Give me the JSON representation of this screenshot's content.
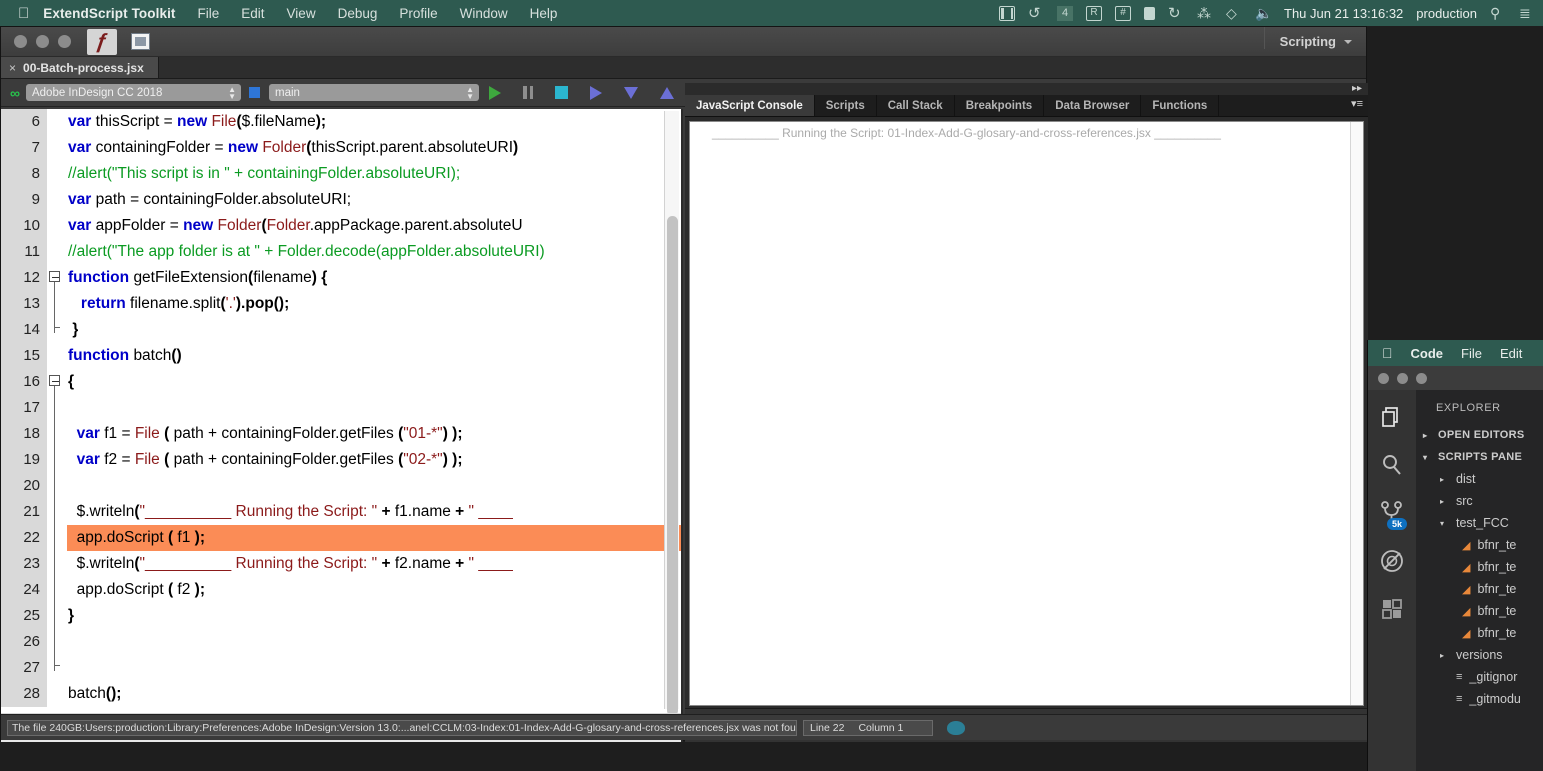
{
  "mac_menu": {
    "apple_icon": "apple-logo-icon",
    "app_name": "ExtendScript Toolkit",
    "items": [
      "File",
      "Edit",
      "View",
      "Debug",
      "Profile",
      "Window",
      "Help"
    ],
    "status_icons": [
      "film-strip-icon",
      "time-machine-icon",
      "four-badge-icon",
      "bartender-icon",
      "grid-icon",
      "lock-icon",
      "backup-icon",
      "bluetooth-icon",
      "vpn-shield-icon",
      "volume-icon"
    ],
    "clock": "Thu Jun 21  13:16:32",
    "user": "production",
    "search_icon": "spotlight-search-icon",
    "list_icon": "notification-center-icon"
  },
  "estk": {
    "window_icons": [
      "extendscript-icon",
      "window-layout-icon"
    ],
    "workspace_label": "Scripting",
    "tab": {
      "close_glyph": "×",
      "title": "00-Batch-process.jsx"
    },
    "toolbar": {
      "chain_icon": "connection-chain-icon",
      "target_app": "Adobe InDesign CC 2018",
      "target_function": "main",
      "buttons": [
        "run-button",
        "pause-button",
        "stop-button",
        "step-over-button",
        "step-into-button",
        "step-out-button"
      ],
      "panel_menu_icon": "panel-menu-icon"
    },
    "code_lines": [
      {
        "n": "6",
        "fold": "",
        "indent": 0,
        "tokens": [
          {
            "t": "var ",
            "c": "kw"
          },
          {
            "t": "thisScript = ",
            "c": ""
          },
          {
            "t": "new ",
            "c": "kw"
          },
          {
            "t": "File",
            "c": "cls"
          },
          {
            "t": "(",
            "c": "bd"
          },
          {
            "t": "$.fileName",
            "c": ""
          },
          {
            "t": ");",
            "c": "bd"
          }
        ]
      },
      {
        "n": "7",
        "fold": "",
        "indent": 0,
        "tokens": [
          {
            "t": "var ",
            "c": "kw"
          },
          {
            "t": "containingFolder = ",
            "c": ""
          },
          {
            "t": "new ",
            "c": "kw"
          },
          {
            "t": "Folder",
            "c": "cls"
          },
          {
            "t": "(",
            "c": "bd"
          },
          {
            "t": "thisScript.parent.absoluteURI",
            "c": ""
          },
          {
            "t": ")",
            "c": "bd"
          }
        ]
      },
      {
        "n": "8",
        "fold": "",
        "indent": 0,
        "tokens": [
          {
            "t": "//alert(\"This script is in \" + containingFolder.absoluteURI);",
            "c": "cm"
          }
        ]
      },
      {
        "n": "9",
        "fold": "",
        "indent": 0,
        "tokens": [
          {
            "t": "var ",
            "c": "kw"
          },
          {
            "t": "path = containingFolder.absoluteURI;",
            "c": ""
          }
        ]
      },
      {
        "n": "10",
        "fold": "",
        "indent": 0,
        "tokens": [
          {
            "t": "var ",
            "c": "kw"
          },
          {
            "t": "appFolder = ",
            "c": ""
          },
          {
            "t": "new ",
            "c": "kw"
          },
          {
            "t": "Folder",
            "c": "cls"
          },
          {
            "t": "(",
            "c": "bd"
          },
          {
            "t": "Folder",
            "c": "cls"
          },
          {
            "t": ".appPackage.parent.absoluteU",
            "c": ""
          }
        ]
      },
      {
        "n": "11",
        "fold": "",
        "indent": 0,
        "tokens": [
          {
            "t": "//alert(\"The app folder is at \" + Folder.decode(appFolder.absoluteURI)",
            "c": "cm"
          }
        ]
      },
      {
        "n": "12",
        "fold": "open",
        "indent": 0,
        "tokens": [
          {
            "t": "function ",
            "c": "kw"
          },
          {
            "t": "getFileExtension",
            "c": ""
          },
          {
            "t": "(",
            "c": "bd"
          },
          {
            "t": "filename",
            "c": ""
          },
          {
            "t": ") {",
            "c": "bd"
          }
        ]
      },
      {
        "n": "13",
        "fold": "bar",
        "indent": 0,
        "tokens": [
          {
            "t": "   ",
            "c": ""
          },
          {
            "t": "return ",
            "c": "kw"
          },
          {
            "t": "filename.split",
            "c": ""
          },
          {
            "t": "(",
            "c": "bd"
          },
          {
            "t": "'.'",
            "c": "st"
          },
          {
            "t": ").pop();",
            "c": "bd"
          }
        ]
      },
      {
        "n": "14",
        "fold": "barend",
        "indent": 0,
        "tokens": [
          {
            "t": " ",
            "c": ""
          },
          {
            "t": "}",
            "c": "bd"
          }
        ]
      },
      {
        "n": "15",
        "fold": "",
        "indent": 0,
        "tokens": [
          {
            "t": "function ",
            "c": "kw"
          },
          {
            "t": "batch",
            "c": ""
          },
          {
            "t": "()",
            "c": "bd"
          }
        ]
      },
      {
        "n": "16",
        "fold": "open",
        "indent": 0,
        "tokens": [
          {
            "t": "{",
            "c": "bd"
          }
        ]
      },
      {
        "n": "17",
        "fold": "bar",
        "indent": 0,
        "tokens": [
          {
            "t": "",
            "c": ""
          }
        ]
      },
      {
        "n": "18",
        "fold": "bar",
        "indent": 0,
        "tokens": [
          {
            "t": "  ",
            "c": ""
          },
          {
            "t": "var ",
            "c": "kw"
          },
          {
            "t": "f1 = ",
            "c": ""
          },
          {
            "t": "File ",
            "c": "cls"
          },
          {
            "t": "(",
            "c": "bd"
          },
          {
            "t": " path + containingFolder.getFiles ",
            "c": ""
          },
          {
            "t": "(",
            "c": "bd"
          },
          {
            "t": "\"01-*\"",
            "c": "st"
          },
          {
            "t": ") );",
            "c": "bd"
          }
        ]
      },
      {
        "n": "19",
        "fold": "bar",
        "indent": 0,
        "tokens": [
          {
            "t": "  ",
            "c": ""
          },
          {
            "t": "var ",
            "c": "kw"
          },
          {
            "t": "f2 = ",
            "c": ""
          },
          {
            "t": "File ",
            "c": "cls"
          },
          {
            "t": "(",
            "c": "bd"
          },
          {
            "t": " path + containingFolder.getFiles ",
            "c": ""
          },
          {
            "t": "(",
            "c": "bd"
          },
          {
            "t": "\"02-*\"",
            "c": "st"
          },
          {
            "t": ") );",
            "c": "bd"
          }
        ]
      },
      {
        "n": "20",
        "fold": "bar",
        "indent": 0,
        "tokens": [
          {
            "t": "",
            "c": ""
          }
        ]
      },
      {
        "n": "21",
        "fold": "bar",
        "indent": 0,
        "tokens": [
          {
            "t": "  $.writeln",
            "c": ""
          },
          {
            "t": "(",
            "c": "bd"
          },
          {
            "t": "\"__________ Running the Script: \"",
            "c": "st"
          },
          {
            "t": " + ",
            "c": "bd"
          },
          {
            "t": "f1.name",
            "c": ""
          },
          {
            "t": " + ",
            "c": "bd"
          },
          {
            "t": "\" ____",
            "c": "st"
          }
        ]
      },
      {
        "n": "22",
        "fold": "bar",
        "indent": 0,
        "highlight": true,
        "tokens": [
          {
            "t": "  app.doScript ",
            "c": ""
          },
          {
            "t": "( ",
            "c": "bd"
          },
          {
            "t": "f1",
            "c": ""
          },
          {
            "t": " );",
            "c": "bd"
          }
        ]
      },
      {
        "n": "23",
        "fold": "bar",
        "indent": 0,
        "tokens": [
          {
            "t": "  $.writeln",
            "c": ""
          },
          {
            "t": "(",
            "c": "bd"
          },
          {
            "t": "\"__________ Running the Script: \"",
            "c": "st"
          },
          {
            "t": " + ",
            "c": "bd"
          },
          {
            "t": "f2.name",
            "c": ""
          },
          {
            "t": " + ",
            "c": "bd"
          },
          {
            "t": "\" ____",
            "c": "st"
          }
        ]
      },
      {
        "n": "24",
        "fold": "bar",
        "indent": 0,
        "tokens": [
          {
            "t": "  app.doScript ",
            "c": ""
          },
          {
            "t": "( ",
            "c": "bd"
          },
          {
            "t": "f2",
            "c": ""
          },
          {
            "t": " );",
            "c": "bd"
          }
        ]
      },
      {
        "n": "25",
        "fold": "bar",
        "indent": 0,
        "tokens": [
          {
            "t": "}",
            "c": "bd"
          }
        ]
      },
      {
        "n": "26",
        "fold": "bar",
        "indent": 0,
        "tokens": [
          {
            "t": "",
            "c": ""
          }
        ]
      },
      {
        "n": "27",
        "fold": "barend",
        "indent": 0,
        "tokens": [
          {
            "t": "",
            "c": ""
          }
        ]
      },
      {
        "n": "28",
        "fold": "",
        "indent": 0,
        "tokens": [
          {
            "t": "batch",
            "c": ""
          },
          {
            "t": "();",
            "c": "bd"
          }
        ]
      }
    ],
    "panels": {
      "tabs": [
        "JavaScript Console",
        "Scripts",
        "Call Stack",
        "Breakpoints",
        "Data Browser",
        "Functions"
      ],
      "active_tab": "JavaScript Console",
      "console_text": "__________ Running the Script: 01-Index-Add-G-glosary-and-cross-references.jsx __________",
      "target_status": "Adobe InDesign CC 2018"
    },
    "status_bar": {
      "message": "The file 240GB:Users:production:Library:Preferences:Adobe InDesign:Version 13.0:...anel:CCLM:03-Index:01-Index-Add-G-glosary-and-cross-references.jsx was not found",
      "line": "Line 22",
      "column": "Column 1"
    }
  },
  "vscode": {
    "menu": {
      "apple_icon": "apple-logo-icon",
      "items": [
        "Code",
        "File",
        "Edit"
      ]
    },
    "activity_items": [
      "explorer-files-icon",
      "search-icon",
      "source-control-icon",
      "run-debug-icon",
      "extensions-icon"
    ],
    "source_control_badge": "5k",
    "sidebar_title": "EXPLORER",
    "sections": [
      {
        "name": "OPEN EDITORS",
        "twisty": "▸"
      },
      {
        "name": "SCRIPTS PANE",
        "twisty": "▾"
      }
    ],
    "tree": [
      {
        "label": "dist",
        "icon": "folder-collapsed",
        "twisty": "▸",
        "depth": 2
      },
      {
        "label": "src",
        "icon": "folder-collapsed",
        "twisty": "▸",
        "depth": 2
      },
      {
        "label": "test_FCC",
        "icon": "folder-expanded",
        "twisty": "▾",
        "depth": 2
      },
      {
        "label": "bfnr_te",
        "icon": "jsx-file-icon",
        "twisty": "",
        "depth": 3
      },
      {
        "label": "bfnr_te",
        "icon": "jsx-file-icon",
        "twisty": "",
        "depth": 3
      },
      {
        "label": "bfnr_te",
        "icon": "jsx-file-icon",
        "twisty": "",
        "depth": 3
      },
      {
        "label": "bfnr_te",
        "icon": "jsx-file-icon",
        "twisty": "",
        "depth": 3
      },
      {
        "label": "bfnr_te",
        "icon": "jsx-file-icon",
        "twisty": "",
        "depth": 3
      },
      {
        "label": "versions",
        "icon": "folder-collapsed",
        "twisty": "▸",
        "depth": 2
      },
      {
        "label": "_gitignor",
        "icon": "text-file-icon",
        "twisty": "",
        "depth": 2
      },
      {
        "label": "_gitmodu",
        "icon": "text-file-icon",
        "twisty": "",
        "depth": 2
      }
    ]
  },
  "colors": {
    "menubar": "#2e5a50",
    "highlight_line": "#fb8c56",
    "keyword": "#0000c8",
    "class": "#8b1a1a",
    "comment": "#0b9b22",
    "accent_badge": "#0e70c0"
  }
}
